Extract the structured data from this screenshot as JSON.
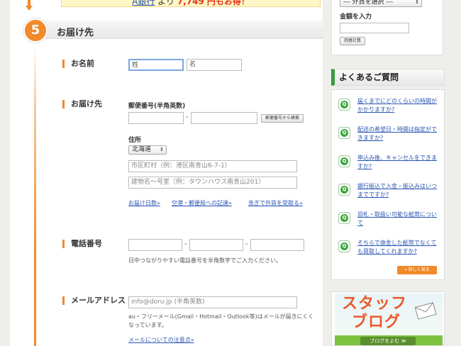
{
  "promo": {
    "bank": "A銀行",
    "yori": "より",
    "amount": "7,749 円もお得！"
  },
  "section": {
    "number": "5",
    "title": "お届け先"
  },
  "name": {
    "label": "お名前",
    "last_placeholder": "姓",
    "first_placeholder": "名"
  },
  "address": {
    "label": "お届け先",
    "postal_label": "郵便番号(半角英数)",
    "postal_search_button": "郵便番号から検索",
    "jusho_label": "住所",
    "prefecture": "北海道",
    "city_placeholder": "市区町村（例：港区南青山6-7-1）",
    "building_placeholder": "建物名～号室（例：タウンハウス南青山201）",
    "links": [
      "お届け日数»",
      "空港・郵便局への記達»",
      "急ぎで外貨を受取る»"
    ]
  },
  "phone": {
    "label": "電話番号",
    "note": "日中つながりやすい電話番号を半角数字でご入力ください。"
  },
  "email": {
    "label": "メールアドレス",
    "placeholder": "info@doru.jp (半角英数)",
    "note": "au・フリーメール(Gmail・Hotmail・Outlook等)はメールが届きにくくなっています。",
    "link": "メールについての注意点»"
  },
  "calculator": {
    "currency_select": "--- 外貨を選択 ---",
    "amount_label": "金額を入力",
    "calc_button": "両替計算"
  },
  "faq": {
    "title": "よくあるご質問",
    "items": [
      "届くまでにどのくらいの時間がかかりますか?",
      "配送の希望日・時間は指定ができますか?",
      "申込み後、キャンセルをできますか?",
      "銀行振込で入金・振込みはいつまでですか?",
      "旧札・取扱い可能な紙幣について",
      "そちらで換金した紙幣でなくても買取してくれますか?"
    ],
    "q_icon": "Q",
    "more_button": "» 詳しく見る"
  },
  "blog": {
    "title_line1": "スタッフ",
    "title_line2": "ブログ",
    "button": "ブログをよむ ≫"
  },
  "colors": {
    "accent": "#f08a2a",
    "link": "#2a55b4",
    "faq_green": "#3ea63e"
  }
}
